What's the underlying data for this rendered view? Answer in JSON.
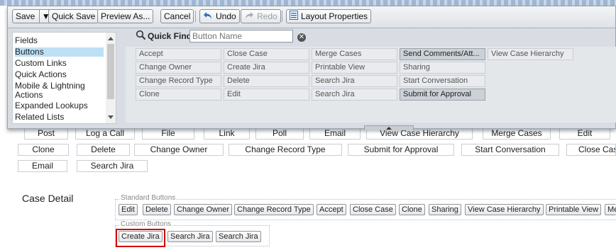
{
  "toolbar": {
    "save": "Save",
    "quick_save": "Quick Save",
    "preview_as": "Preview As...",
    "cancel": "Cancel",
    "undo": "Undo",
    "redo": "Redo",
    "layout_properties": "Layout Properties"
  },
  "categories": [
    "Fields",
    "Buttons",
    "Custom Links",
    "Quick Actions",
    "Mobile & Lightning Actions",
    "Expanded Lookups",
    "Related Lists"
  ],
  "selected_category": "Buttons",
  "quick_find": {
    "label": "Quick Find",
    "placeholder": "Button Name"
  },
  "palette_buttons": [
    [
      "Accept",
      "Close Case",
      "Merge Cases",
      "Send Comments/Att...",
      "View Case Hierarchy"
    ],
    [
      "Change Owner",
      "Create Jira",
      "Printable View",
      "Sharing"
    ],
    [
      "Change Record Type",
      "Delete",
      "Search Jira",
      "Start Conversation"
    ],
    [
      "Clone",
      "Edit",
      "Search Jira",
      "Submit for Approval"
    ]
  ],
  "used_palette_buttons": [
    "Send Comments/Att...",
    "Submit for Approval"
  ],
  "layout_row0": [
    "Post",
    "Log a Call",
    "File",
    "Link",
    "Poll",
    "Email",
    "View Case Hierarchy",
    "Merge Cases",
    "Edit"
  ],
  "layout_row1": [
    "Clone",
    "Delete",
    "Change Owner",
    "Change Record Type",
    "Submit for Approval",
    "Start Conversation",
    "Close Case"
  ],
  "layout_row2": [
    "Email",
    "Search Jira"
  ],
  "case_detail": {
    "title": "Case Detail",
    "standard_label": "Standard Buttons",
    "standard_buttons": [
      "Edit",
      "Delete",
      "Change Owner",
      "Change Record Type",
      "Accept",
      "Close Case",
      "Clone",
      "Sharing",
      "View Case Hierarchy",
      "Printable View",
      "Me"
    ],
    "custom_label": "Custom Buttons",
    "custom_buttons": [
      "Create Jira",
      "Search Jira",
      "Search Jira"
    ]
  },
  "colors": {
    "highlight": "#d00000",
    "selected_category": "#bde0f5"
  }
}
